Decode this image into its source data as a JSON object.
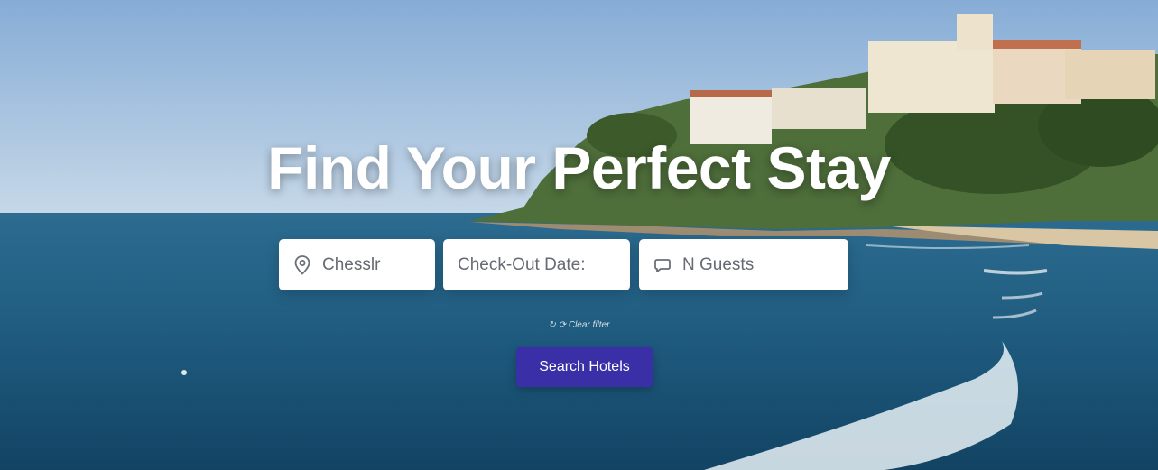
{
  "hero": {
    "title": "Find Your Perfect Stay",
    "hint": "↻ ⟳ Clear filter"
  },
  "search": {
    "check_in": {
      "text": "Chesslr",
      "icon": "map-pin-icon"
    },
    "check_out": {
      "text": "Check-Out Date:"
    },
    "guests": {
      "text": "N Guests",
      "icon": "chat-bubble-icon"
    },
    "submit_label": "Search Hotels"
  },
  "colors": {
    "button": "#3b2fa8",
    "field_bg": "#ffffff",
    "title": "#ffffff"
  }
}
